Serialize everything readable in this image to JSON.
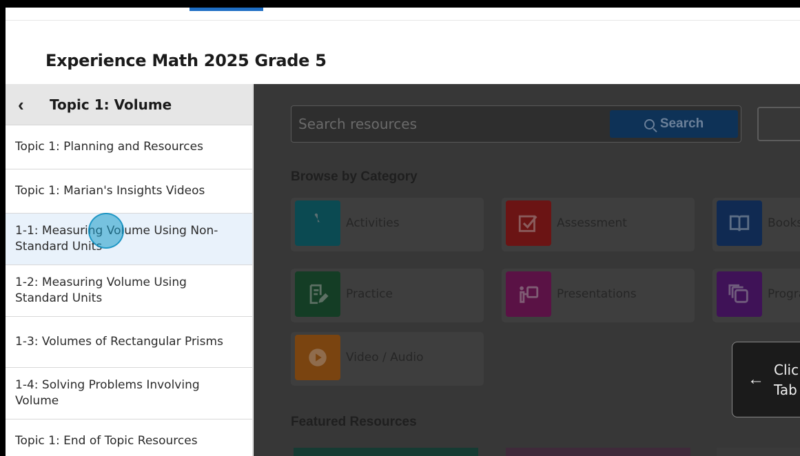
{
  "header": {
    "title": "Experience Math 2025 Grade 5"
  },
  "sidebar": {
    "back_label": "Topic 1: Volume",
    "items": [
      {
        "label": "Topic 1: Planning and Resources"
      },
      {
        "label": "Topic 1: Marian's Insights Videos"
      },
      {
        "label": "1-1: Measuring Volume Using Non-Standard Units"
      },
      {
        "label": "1-2: Measuring Volume Using Standard Units"
      },
      {
        "label": "1-3: Volumes of Rectangular Prisms"
      },
      {
        "label": "1-4: Solving Problems Involving Volume"
      },
      {
        "label": "Topic 1: End of Topic Resources"
      }
    ]
  },
  "search": {
    "placeholder": "Search resources",
    "button_label": "Search"
  },
  "browse": {
    "title": "Browse by Category",
    "categories": [
      {
        "label": "Activities",
        "icon": "hand-pointer-icon",
        "color": "#0b4a52"
      },
      {
        "label": "Assessment",
        "icon": "checkbox-icon",
        "color": "#6b1414"
      },
      {
        "label": "Books /",
        "icon": "book-icon",
        "color": "#102a52"
      },
      {
        "label": "Practice",
        "icon": "pencil-doc-icon",
        "color": "#143d25"
      },
      {
        "label": "Presentations",
        "icon": "presentation-icon",
        "color": "#5a1245"
      },
      {
        "label": "Progra",
        "icon": "stack-icon",
        "color": "#3f1257"
      },
      {
        "label": "Video / Audio",
        "icon": "play-icon",
        "color": "#7a4410"
      }
    ]
  },
  "featured": {
    "title": "Featured Resources"
  },
  "callout": {
    "line1": "Clic",
    "line2": "Tab"
  },
  "colors": {
    "accent": "#1f6fc5",
    "active_item_bg": "#e9f2fb",
    "overlay_bg": "#373737"
  }
}
